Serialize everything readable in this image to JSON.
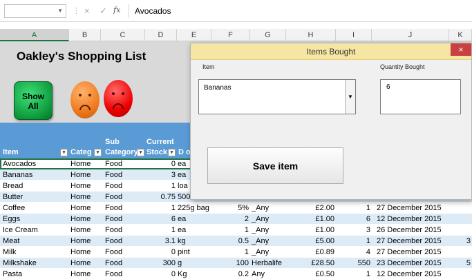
{
  "formula_bar": {
    "cancel_icon": "×",
    "enter_icon": "✓",
    "fx_icon": "fx",
    "value": "Avocados"
  },
  "columns": [
    "A",
    "B",
    "C",
    "D",
    "E",
    "F",
    "G",
    "H",
    "I",
    "J",
    "K"
  ],
  "sheet": {
    "title": "Oakley's Shopping List",
    "show_all_label_1": "Show",
    "show_all_label_2": "All"
  },
  "table": {
    "headers": {
      "item": "Item",
      "category": "Categ",
      "sub1": "Sub",
      "sub2": "Category",
      "cur1": "Current",
      "cur2": "Stock",
      "d": "D o"
    },
    "rows": [
      [
        "Avocados",
        "Home",
        "Food",
        "0",
        "ea",
        "",
        "",
        "",
        "",
        ""
      ],
      [
        "Bananas",
        "Home",
        "Food",
        "3",
        "ea",
        "",
        "",
        "",
        "",
        ""
      ],
      [
        "Bread",
        "Home",
        "Food",
        "1",
        "loa",
        "",
        "",
        "",
        "",
        ""
      ],
      [
        "Butter",
        "Home",
        "Food",
        "0.75",
        "500",
        "",
        "",
        "",
        "",
        ""
      ],
      [
        "Coffee",
        "Home",
        "Food",
        "1",
        "225g bag",
        "5%",
        "_Any",
        "£2.00",
        "1",
        "27 December 2015"
      ],
      [
        "Eggs",
        "Home",
        "Food",
        "6",
        "ea",
        "2",
        "_Any",
        "£1.00",
        "6",
        "12 December 2015"
      ],
      [
        "Ice Cream",
        "Home",
        "Food",
        "1",
        "ea",
        "1",
        "_Any",
        "£1.00",
        "3",
        "26 December 2015"
      ],
      [
        "Meat",
        "Home",
        "Food",
        "3.1",
        "kg",
        "0.5",
        "_Any",
        "£5.00",
        "1",
        "27 December 2015"
      ],
      [
        "Milk",
        "Home",
        "Food",
        "0",
        "pint",
        "1",
        "_Any",
        "£0.89",
        "4",
        "27 December 2015"
      ],
      [
        "Milkshake",
        "Home",
        "Food",
        "300",
        "g",
        "100",
        "Herbalife",
        "£28.50",
        "550",
        "23 December 2015"
      ],
      [
        "Pasta",
        "Home",
        "Food",
        "0",
        "Kg",
        "0.2",
        "Any",
        "£0.50",
        "1",
        "12 December 2015"
      ]
    ],
    "k_col": [
      "",
      "",
      "",
      "",
      "",
      "",
      "",
      "3",
      "",
      "5",
      ""
    ]
  },
  "dialog": {
    "title": "Items Bought",
    "close_icon": "×",
    "item_label": "Item",
    "item_value": "Bananas",
    "qty_label": "Quantity Bought",
    "qty_value": "6",
    "save_label": "Save item"
  },
  "colors": {
    "table_header": "#5b9bd5",
    "band": "#ddebf7",
    "dialog_title": "#f6e6a3",
    "close": "#c84040",
    "show_all": "#0e9a3d"
  }
}
